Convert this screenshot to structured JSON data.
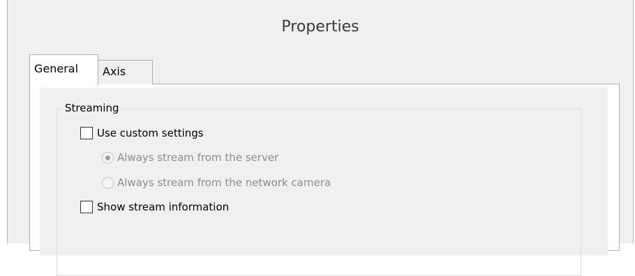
{
  "window": {
    "title": "Properties"
  },
  "tabs": [
    {
      "label": "General",
      "selected": true
    },
    {
      "label": "Axis",
      "selected": false
    }
  ],
  "streaming": {
    "group_label": "Streaming",
    "use_custom_settings": {
      "label": "Use custom settings",
      "checked": false
    },
    "stream_from_server": {
      "label": "Always stream from the server",
      "selected": true,
      "enabled": false
    },
    "stream_from_camera": {
      "label": "Always stream from the network camera",
      "selected": false,
      "enabled": false
    },
    "show_stream_info": {
      "label": "Show stream information",
      "checked": false
    }
  },
  "colors": {
    "window_bg": "#f0f0f0",
    "pane_bg": "#ffffff",
    "disabled_text": "#8d8d8d",
    "border": "#adadad"
  }
}
